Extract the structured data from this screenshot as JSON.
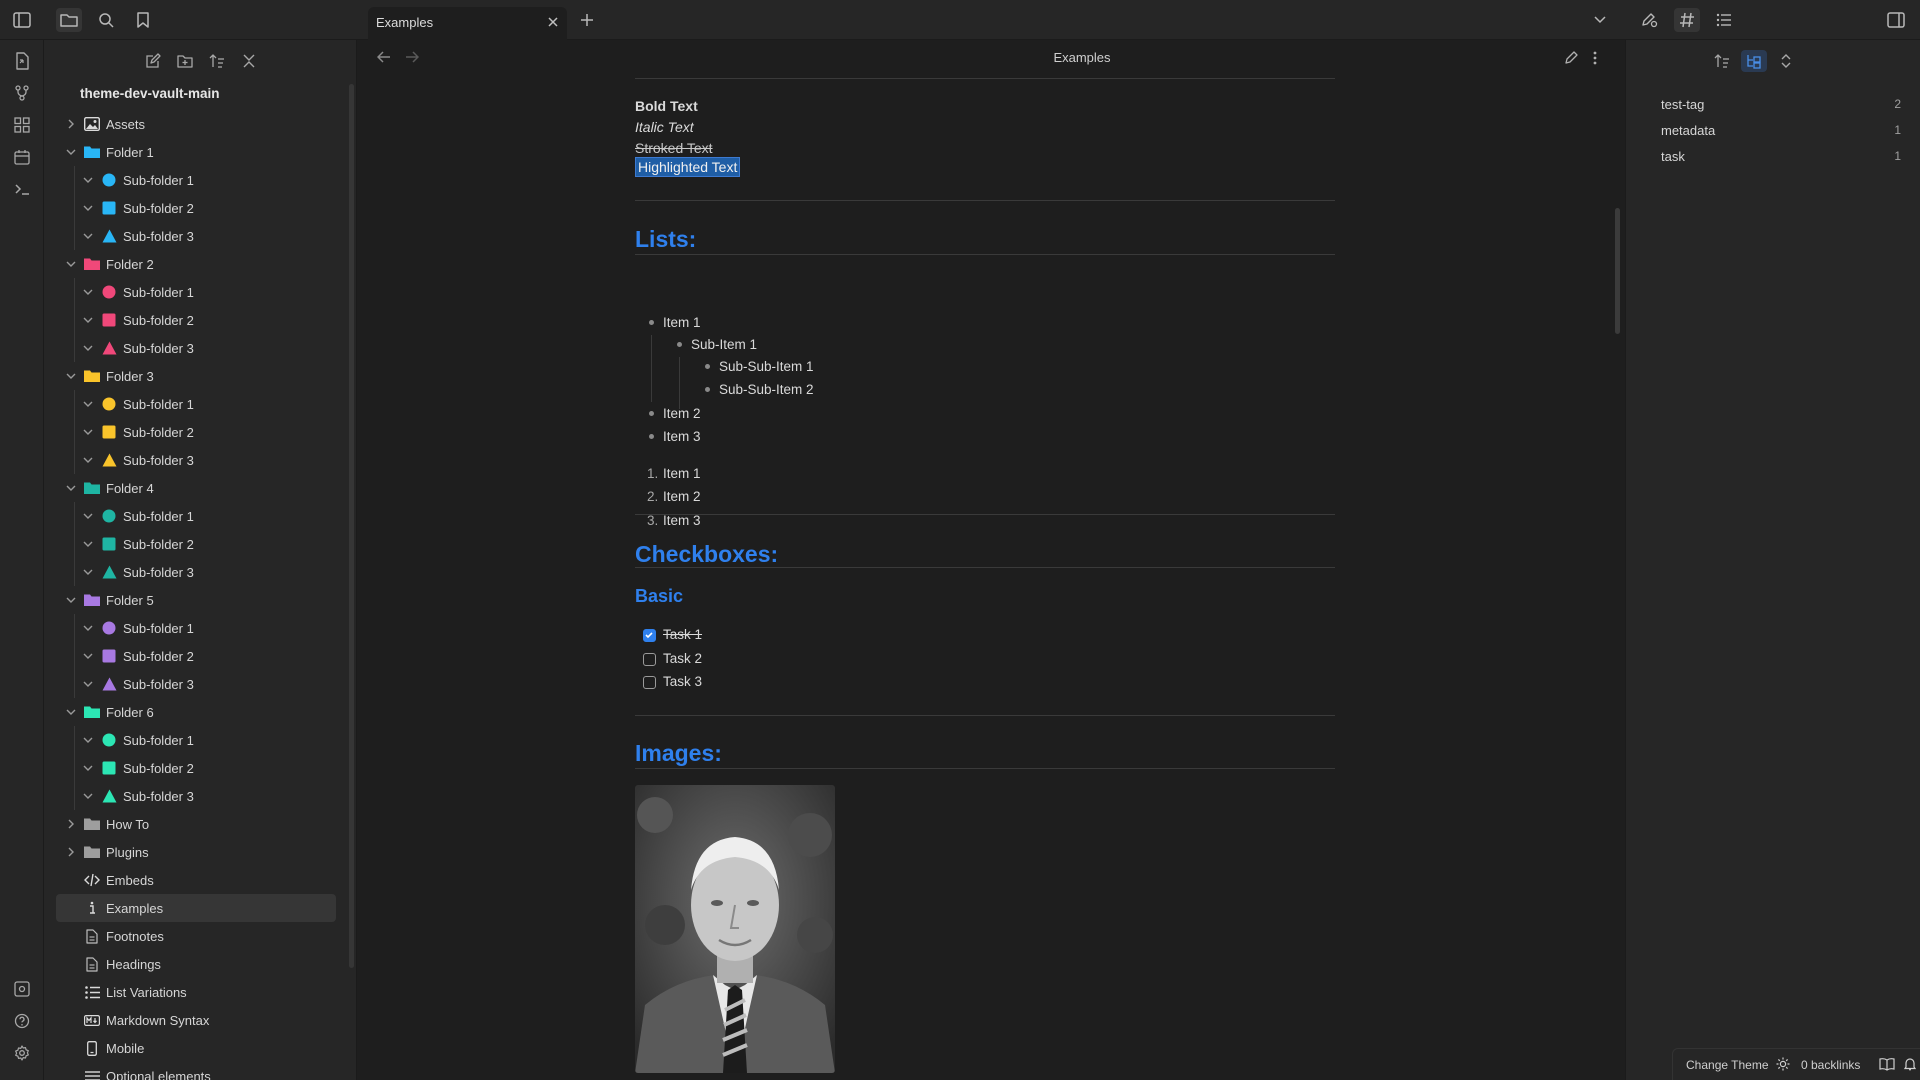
{
  "tab": {
    "title": "Examples"
  },
  "sidebar": {
    "vault_name": "theme-dev-vault-main",
    "tree": [
      {
        "depth": 0,
        "label": "Assets",
        "icon": "image-icon",
        "color": "#dadada",
        "chevron": "right"
      },
      {
        "depth": 0,
        "label": "Folder 1",
        "icon": "folder-icon",
        "color": "#29b6f6",
        "chevron": "down"
      },
      {
        "depth": 1,
        "label": "Sub-folder 1",
        "icon": "circle-icon",
        "color": "#29b6f6",
        "chevron": "down"
      },
      {
        "depth": 1,
        "label": "Sub-folder 2",
        "icon": "square-icon",
        "color": "#29b6f6",
        "chevron": "down"
      },
      {
        "depth": 1,
        "label": "Sub-folder 3",
        "icon": "triangle-icon",
        "color": "#29b6f6",
        "chevron": "down"
      },
      {
        "depth": 0,
        "label": "Folder 2",
        "icon": "folder-icon",
        "color": "#f0487a",
        "chevron": "down"
      },
      {
        "depth": 1,
        "label": "Sub-folder 1",
        "icon": "circle-icon",
        "color": "#f0487a",
        "chevron": "down"
      },
      {
        "depth": 1,
        "label": "Sub-folder 2",
        "icon": "square-icon",
        "color": "#f0487a",
        "chevron": "down"
      },
      {
        "depth": 1,
        "label": "Sub-folder 3",
        "icon": "triangle-icon",
        "color": "#f0487a",
        "chevron": "down"
      },
      {
        "depth": 0,
        "label": "Folder 3",
        "icon": "folder-icon",
        "color": "#f9c42b",
        "chevron": "down"
      },
      {
        "depth": 1,
        "label": "Sub-folder 1",
        "icon": "circle-icon",
        "color": "#f9c42b",
        "chevron": "down"
      },
      {
        "depth": 1,
        "label": "Sub-folder 2",
        "icon": "square-icon",
        "color": "#f9c42b",
        "chevron": "down"
      },
      {
        "depth": 1,
        "label": "Sub-folder 3",
        "icon": "triangle-icon",
        "color": "#f9c42b",
        "chevron": "down"
      },
      {
        "depth": 0,
        "label": "Folder 4",
        "icon": "folder-icon",
        "color": "#1fb5a3",
        "chevron": "down"
      },
      {
        "depth": 1,
        "label": "Sub-folder 1",
        "icon": "circle-icon",
        "color": "#1fb5a3",
        "chevron": "down"
      },
      {
        "depth": 1,
        "label": "Sub-folder 2",
        "icon": "square-icon",
        "color": "#1fb5a3",
        "chevron": "down"
      },
      {
        "depth": 1,
        "label": "Sub-folder 3",
        "icon": "triangle-icon",
        "color": "#1fb5a3",
        "chevron": "down"
      },
      {
        "depth": 0,
        "label": "Folder 5",
        "icon": "folder-icon",
        "color": "#a879e2",
        "chevron": "down"
      },
      {
        "depth": 1,
        "label": "Sub-folder 1",
        "icon": "circle-icon",
        "color": "#a879e2",
        "chevron": "down"
      },
      {
        "depth": 1,
        "label": "Sub-folder 2",
        "icon": "square-icon",
        "color": "#a879e2",
        "chevron": "down"
      },
      {
        "depth": 1,
        "label": "Sub-folder 3",
        "icon": "triangle-icon",
        "color": "#a879e2",
        "chevron": "down"
      },
      {
        "depth": 0,
        "label": "Folder 6",
        "icon": "folder-icon",
        "color": "#2ce6b4",
        "chevron": "down"
      },
      {
        "depth": 1,
        "label": "Sub-folder 1",
        "icon": "circle-icon",
        "color": "#2ce6b4",
        "chevron": "down"
      },
      {
        "depth": 1,
        "label": "Sub-folder 2",
        "icon": "square-icon",
        "color": "#2ce6b4",
        "chevron": "down"
      },
      {
        "depth": 1,
        "label": "Sub-folder 3",
        "icon": "triangle-icon",
        "color": "#2ce6b4",
        "chevron": "down"
      },
      {
        "depth": 0,
        "label": "How To",
        "icon": "folder-icon",
        "color": "#9e9e9e",
        "chevron": "right"
      },
      {
        "depth": 0,
        "label": "Plugins",
        "icon": "folder-icon",
        "color": "#9e9e9e",
        "chevron": "right"
      },
      {
        "depth": 0,
        "label": "Embeds",
        "icon": "code-icon",
        "color": "#dadada",
        "chevron": "none"
      },
      {
        "depth": 0,
        "label": "Examples",
        "icon": "info-icon",
        "color": "#dadada",
        "chevron": "none",
        "selected": true
      },
      {
        "depth": 0,
        "label": "Footnotes",
        "icon": "file-icon",
        "color": "#bdbdbd",
        "chevron": "none"
      },
      {
        "depth": 0,
        "label": "Headings",
        "icon": "file-icon",
        "color": "#bdbdbd",
        "chevron": "none"
      },
      {
        "depth": 0,
        "label": "List Variations",
        "icon": "list-icon",
        "color": "#dadada",
        "chevron": "none"
      },
      {
        "depth": 0,
        "label": "Markdown Syntax",
        "icon": "markdown-icon",
        "color": "#dadada",
        "chevron": "none"
      },
      {
        "depth": 0,
        "label": "Mobile",
        "icon": "mobile-icon",
        "color": "#dadada",
        "chevron": "none"
      },
      {
        "depth": 0,
        "label": "Optional elements",
        "icon": "lines-icon",
        "color": "#dadada",
        "chevron": "none"
      }
    ]
  },
  "editor": {
    "view_title": "Examples",
    "bold_text": "Bold Text",
    "italic_text": "Italic Text",
    "stroked_text": "Stroked Text",
    "highlighted_text": "Highlighted Text",
    "lists_heading": "Lists:",
    "ul": [
      {
        "level": 0,
        "text": "Item 1"
      },
      {
        "level": 1,
        "text": "Sub-Item 1"
      },
      {
        "level": 2,
        "text": "Sub-Sub-Item 1"
      },
      {
        "level": 2,
        "text": "Sub-Sub-Item 2"
      },
      {
        "level": 0,
        "text": "Item 2"
      },
      {
        "level": 0,
        "text": "Item 3"
      }
    ],
    "ol": [
      {
        "num": "1.",
        "text": "Item 1"
      },
      {
        "num": "2.",
        "text": "Item 2"
      },
      {
        "num": "3.",
        "text": "Item 3"
      }
    ],
    "checkboxes_heading": "Checkboxes:",
    "basic_heading": "Basic",
    "tasks": [
      {
        "text": "Task 1",
        "checked": true
      },
      {
        "text": "Task 2",
        "checked": false
      },
      {
        "text": "Task 3",
        "checked": false
      }
    ],
    "images_heading": "Images:",
    "accent_color": "#2f80ed"
  },
  "tags": [
    {
      "name": "test-tag",
      "count": "2"
    },
    {
      "name": "metadata",
      "count": "1"
    },
    {
      "name": "task",
      "count": "1"
    }
  ],
  "status": {
    "change_theme": "Change Theme",
    "backlinks": "0 backlinks"
  }
}
